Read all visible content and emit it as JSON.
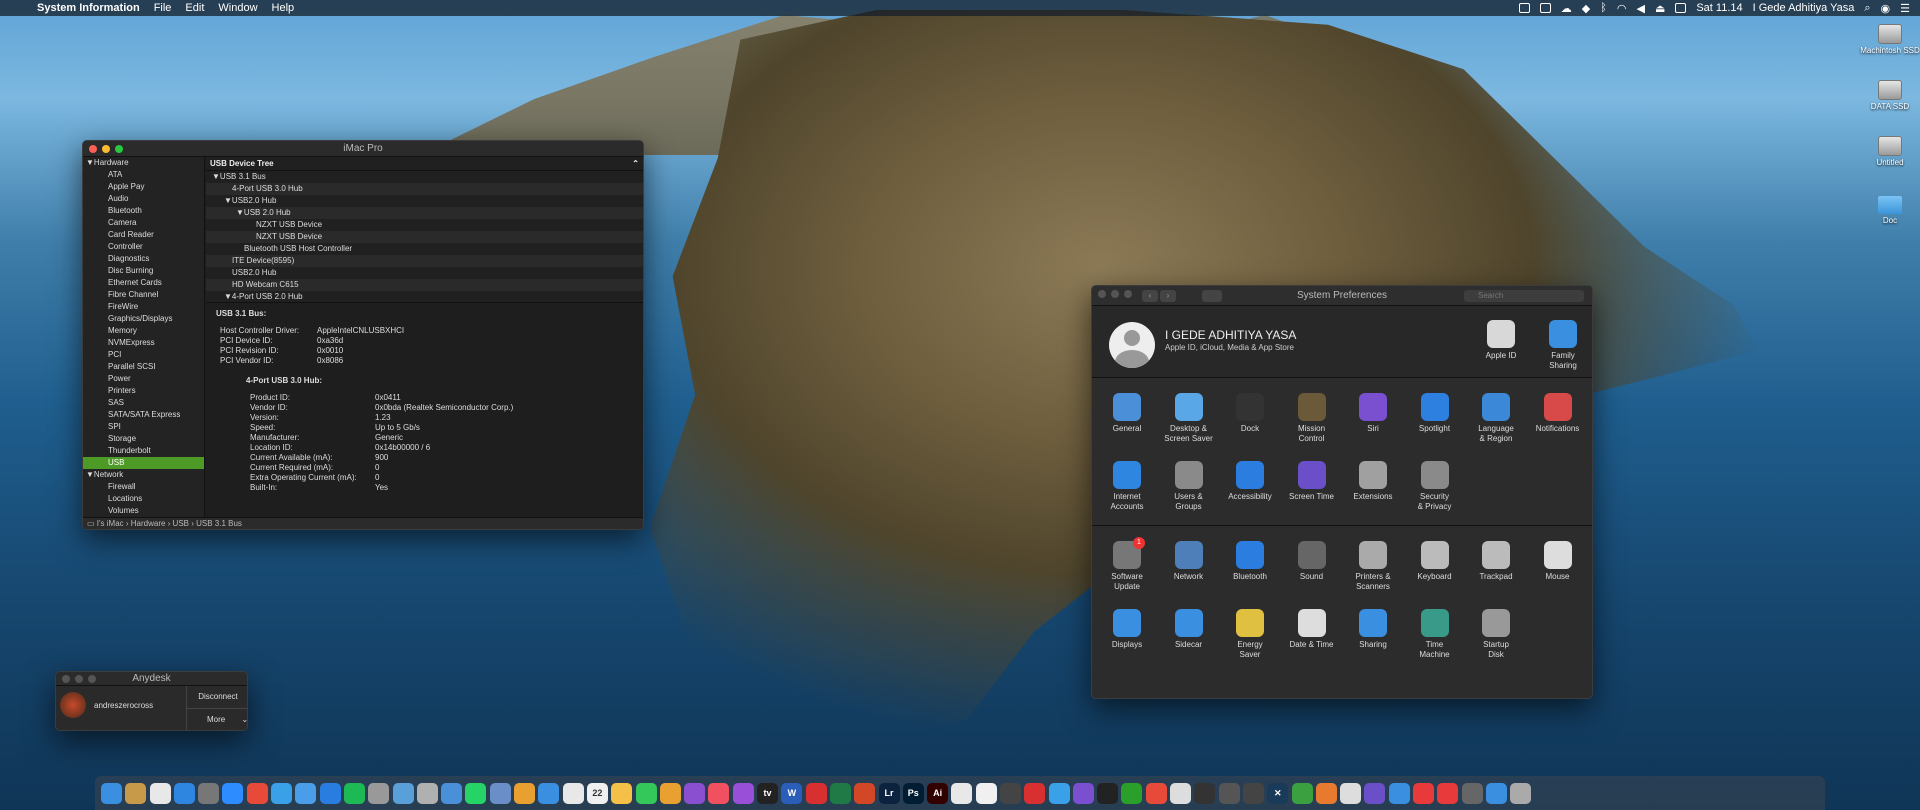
{
  "menubar": {
    "apple": "",
    "app_name": "System Information",
    "menus": [
      "File",
      "Edit",
      "Window",
      "Help"
    ],
    "clock": "Sat 11.14",
    "user": "I Gede Adhitiya Yasa"
  },
  "desktop_icons": [
    "Machintosh SSD",
    "DATA SSD",
    "Untitled",
    "Doc"
  ],
  "sysinfo": {
    "title": "iMac Pro",
    "sidebar": {
      "hardware_label": "Hardware",
      "hardware_items": [
        "ATA",
        "Apple Pay",
        "Audio",
        "Bluetooth",
        "Camera",
        "Card Reader",
        "Controller",
        "Diagnostics",
        "Disc Burning",
        "Ethernet Cards",
        "Fibre Channel",
        "FireWire",
        "Graphics/Displays",
        "Memory",
        "NVMExpress",
        "PCI",
        "Parallel SCSI",
        "Power",
        "Printers",
        "SAS",
        "SATA/SATA Express",
        "SPI",
        "Storage",
        "Thunderbolt",
        "USB"
      ],
      "network_label": "Network",
      "network_items": [
        "Firewall",
        "Locations",
        "Volumes"
      ]
    },
    "tree_header": "USB Device Tree",
    "tree": [
      {
        "label": "USB 3.1 Bus",
        "indent": 0,
        "arrow": "▼"
      },
      {
        "label": "4-Port USB 3.0 Hub",
        "indent": 1,
        "arrow": ""
      },
      {
        "label": "USB2.0 Hub",
        "indent": 1,
        "arrow": "▼"
      },
      {
        "label": "USB 2.0 Hub",
        "indent": 2,
        "arrow": "▼"
      },
      {
        "label": "NZXT USB Device",
        "indent": 3,
        "arrow": ""
      },
      {
        "label": "NZXT USB Device",
        "indent": 3,
        "arrow": ""
      },
      {
        "label": "Bluetooth USB Host Controller",
        "indent": 2,
        "arrow": ""
      },
      {
        "label": "ITE Device(8595)",
        "indent": 1,
        "arrow": ""
      },
      {
        "label": "USB2.0 Hub",
        "indent": 1,
        "arrow": ""
      },
      {
        "label": "HD Webcam C615",
        "indent": 1,
        "arrow": ""
      },
      {
        "label": "4-Port USB 2.0 Hub",
        "indent": 1,
        "arrow": "▼"
      }
    ],
    "detail": {
      "heading": "USB 3.1 Bus:",
      "bus_props": [
        {
          "k": "Host Controller Driver:",
          "v": "AppleIntelCNLUSBXHCI"
        },
        {
          "k": "PCI Device ID:",
          "v": "0xa36d"
        },
        {
          "k": "PCI Revision ID:",
          "v": "0x0010"
        },
        {
          "k": "PCI Vendor ID:",
          "v": "0x8086"
        }
      ],
      "sub_heading": "4-Port USB 3.0 Hub:",
      "hub_props": [
        {
          "k": "Product ID:",
          "v": "0x0411"
        },
        {
          "k": "Vendor ID:",
          "v": "0x0bda  (Realtek Semiconductor Corp.)"
        },
        {
          "k": "Version:",
          "v": "1.23"
        },
        {
          "k": "Speed:",
          "v": "Up to 5 Gb/s"
        },
        {
          "k": "Manufacturer:",
          "v": "Generic"
        },
        {
          "k": "Location ID:",
          "v": "0x14b00000 / 6"
        },
        {
          "k": "Current Available (mA):",
          "v": "900"
        },
        {
          "k": "Current Required (mA):",
          "v": "0"
        },
        {
          "k": "Extra Operating Current (mA):",
          "v": "0"
        },
        {
          "k": "Built-In:",
          "v": "Yes"
        }
      ]
    },
    "path": "I's iMac › Hardware › USB › USB 3.1 Bus"
  },
  "sysprefs": {
    "title": "System Preferences",
    "search_placeholder": "Search",
    "user_name": "I GEDE ADHITIYA YASA",
    "user_sub": "Apple ID, iCloud, Media & App Store",
    "top_items": [
      {
        "label": "Apple ID",
        "color": "#d8d8d8"
      },
      {
        "label": "Family\nSharing",
        "color": "#3a8fe0"
      }
    ],
    "row1": [
      {
        "label": "General",
        "color": "#4a8fd8"
      },
      {
        "label": "Desktop &\nScreen Saver",
        "color": "#5aa7e8"
      },
      {
        "label": "Dock",
        "color": "#333333"
      },
      {
        "label": "Mission\nControl",
        "color": "#6b5a3a"
      },
      {
        "label": "Siri",
        "color": "#7a4fd0"
      },
      {
        "label": "Spotlight",
        "color": "#2d7fe0"
      },
      {
        "label": "Language\n& Region",
        "color": "#3b88d8"
      },
      {
        "label": "Notifications",
        "color": "#d84a4a"
      }
    ],
    "row2": [
      {
        "label": "Internet\nAccounts",
        "color": "#2f86e0"
      },
      {
        "label": "Users &\nGroups",
        "color": "#8a8a8a"
      },
      {
        "label": "Accessibility",
        "color": "#2c7de0"
      },
      {
        "label": "Screen Time",
        "color": "#6a4fc8"
      },
      {
        "label": "Extensions",
        "color": "#a0a0a0"
      },
      {
        "label": "Security\n& Privacy",
        "color": "#8a8a8a"
      }
    ],
    "row3": [
      {
        "label": "Software\nUpdate",
        "color": "#777777",
        "badge": "1"
      },
      {
        "label": "Network",
        "color": "#4f7fb8"
      },
      {
        "label": "Bluetooth",
        "color": "#2b7ee0"
      },
      {
        "label": "Sound",
        "color": "#666666"
      },
      {
        "label": "Printers &\nScanners",
        "color": "#aaaaaa"
      },
      {
        "label": "Keyboard",
        "color": "#bbbbbb"
      },
      {
        "label": "Trackpad",
        "color": "#bbbbbb"
      },
      {
        "label": "Mouse",
        "color": "#dddddd"
      }
    ],
    "row4": [
      {
        "label": "Displays",
        "color": "#3a8fe0"
      },
      {
        "label": "Sidecar",
        "color": "#3a8fe0"
      },
      {
        "label": "Energy\nSaver",
        "color": "#e0c040"
      },
      {
        "label": "Date & Time",
        "color": "#dddddd"
      },
      {
        "label": "Sharing",
        "color": "#3a8fe0"
      },
      {
        "label": "Time\nMachine",
        "color": "#3a9a8a"
      },
      {
        "label": "Startup\nDisk",
        "color": "#999999"
      }
    ]
  },
  "anydesk": {
    "title": "Anydesk",
    "user": "andreszerocross",
    "disconnect": "Disconnect",
    "more": "More"
  },
  "dock": [
    {
      "name": "finder",
      "color": "#3b8fe0",
      "text": ""
    },
    {
      "name": "notes-app",
      "color": "#c79a4a",
      "text": ""
    },
    {
      "name": "media-player",
      "color": "#e8e8e8",
      "text": ""
    },
    {
      "name": "app-store",
      "color": "#2f86e0",
      "text": ""
    },
    {
      "name": "system-prefs",
      "color": "#777",
      "text": ""
    },
    {
      "name": "zoom",
      "color": "#2d8cff",
      "text": ""
    },
    {
      "name": "anydesk",
      "color": "#e84a3a",
      "text": ""
    },
    {
      "name": "tweetbot",
      "color": "#3aa0e8",
      "text": ""
    },
    {
      "name": "cloud-app",
      "color": "#4a9de8",
      "text": ""
    },
    {
      "name": "trello",
      "color": "#2a7de0",
      "text": ""
    },
    {
      "name": "spotify",
      "color": "#1db954",
      "text": ""
    },
    {
      "name": "script-editor",
      "color": "#999",
      "text": ""
    },
    {
      "name": "mountain",
      "color": "#5aa0d8",
      "text": ""
    },
    {
      "name": "archive",
      "color": "#b0b0b0",
      "text": ""
    },
    {
      "name": "preview",
      "color": "#4a90d8",
      "text": ""
    },
    {
      "name": "whatsapp",
      "color": "#25d366",
      "text": ""
    },
    {
      "name": "launchpad",
      "color": "#6a8fc8",
      "text": ""
    },
    {
      "name": "paw",
      "color": "#e8a030",
      "text": ""
    },
    {
      "name": "safari",
      "color": "#3a8fe0",
      "text": ""
    },
    {
      "name": "chrome",
      "color": "#e8e8e8",
      "text": ""
    },
    {
      "name": "calendar",
      "color": "#f0f0f0",
      "text": "22"
    },
    {
      "name": "photos",
      "color": "#f4c048",
      "text": ""
    },
    {
      "name": "messages",
      "color": "#34c759",
      "text": ""
    },
    {
      "name": "clipboard",
      "color": "#e8a030",
      "text": ""
    },
    {
      "name": "omnifocus",
      "color": "#8a4fd0",
      "text": ""
    },
    {
      "name": "music",
      "color": "#f05060",
      "text": ""
    },
    {
      "name": "podcasts",
      "color": "#9a4fd8",
      "text": ""
    },
    {
      "name": "appletv",
      "color": "#222",
      "text": "tv"
    },
    {
      "name": "word",
      "color": "#2b5eb8",
      "text": "W"
    },
    {
      "name": "acrobat",
      "color": "#d83030",
      "text": ""
    },
    {
      "name": "excel",
      "color": "#1f7a45",
      "text": ""
    },
    {
      "name": "powerpoint",
      "color": "#d24726",
      "text": ""
    },
    {
      "name": "lightroom",
      "color": "#0c2340",
      "text": "Lr"
    },
    {
      "name": "photoshop",
      "color": "#001d34",
      "text": "Ps"
    },
    {
      "name": "illustrator",
      "color": "#330000",
      "text": "Ai"
    },
    {
      "name": "notes2",
      "color": "#e8e8e8",
      "text": ""
    },
    {
      "name": "volleyball",
      "color": "#f0f0f0",
      "text": ""
    },
    {
      "name": "fcpx",
      "color": "#444",
      "text": ""
    },
    {
      "name": "pdf-app",
      "color": "#d83030",
      "text": ""
    },
    {
      "name": "affinity",
      "color": "#3aa0e8",
      "text": ""
    },
    {
      "name": "affinity-photo",
      "color": "#7a4fd0",
      "text": ""
    },
    {
      "name": "pen",
      "color": "#222",
      "text": ""
    },
    {
      "name": "qbittorrent",
      "color": "#2aa02a",
      "text": ""
    },
    {
      "name": "sketch",
      "color": "#e84a3a",
      "text": ""
    },
    {
      "name": "bartender",
      "color": "#ddd",
      "text": ""
    },
    {
      "name": "car1",
      "color": "#333",
      "text": ""
    },
    {
      "name": "car2",
      "color": "#555",
      "text": ""
    },
    {
      "name": "car3",
      "color": "#444",
      "text": ""
    },
    {
      "name": "xcode-x",
      "color": "#1a3a5a",
      "text": "✕"
    },
    {
      "name": "utorrent",
      "color": "#3aa040",
      "text": ""
    },
    {
      "name": "stripes",
      "color": "#e87a30",
      "text": ""
    },
    {
      "name": "scroll",
      "color": "#ddd",
      "text": ""
    },
    {
      "name": "imovie",
      "color": "#6a4fc8",
      "text": ""
    },
    {
      "name": "airdrop",
      "color": "#3a8fe0",
      "text": ""
    },
    {
      "name": "screen1",
      "color": "#e83a3a",
      "text": ""
    },
    {
      "name": "screen2",
      "color": "#e83a3a",
      "text": ""
    },
    {
      "name": "silhouette",
      "color": "#666",
      "text": ""
    },
    {
      "name": "downloads",
      "color": "#3a8fe0",
      "text": ""
    },
    {
      "name": "trash",
      "color": "#aaa",
      "text": ""
    }
  ]
}
